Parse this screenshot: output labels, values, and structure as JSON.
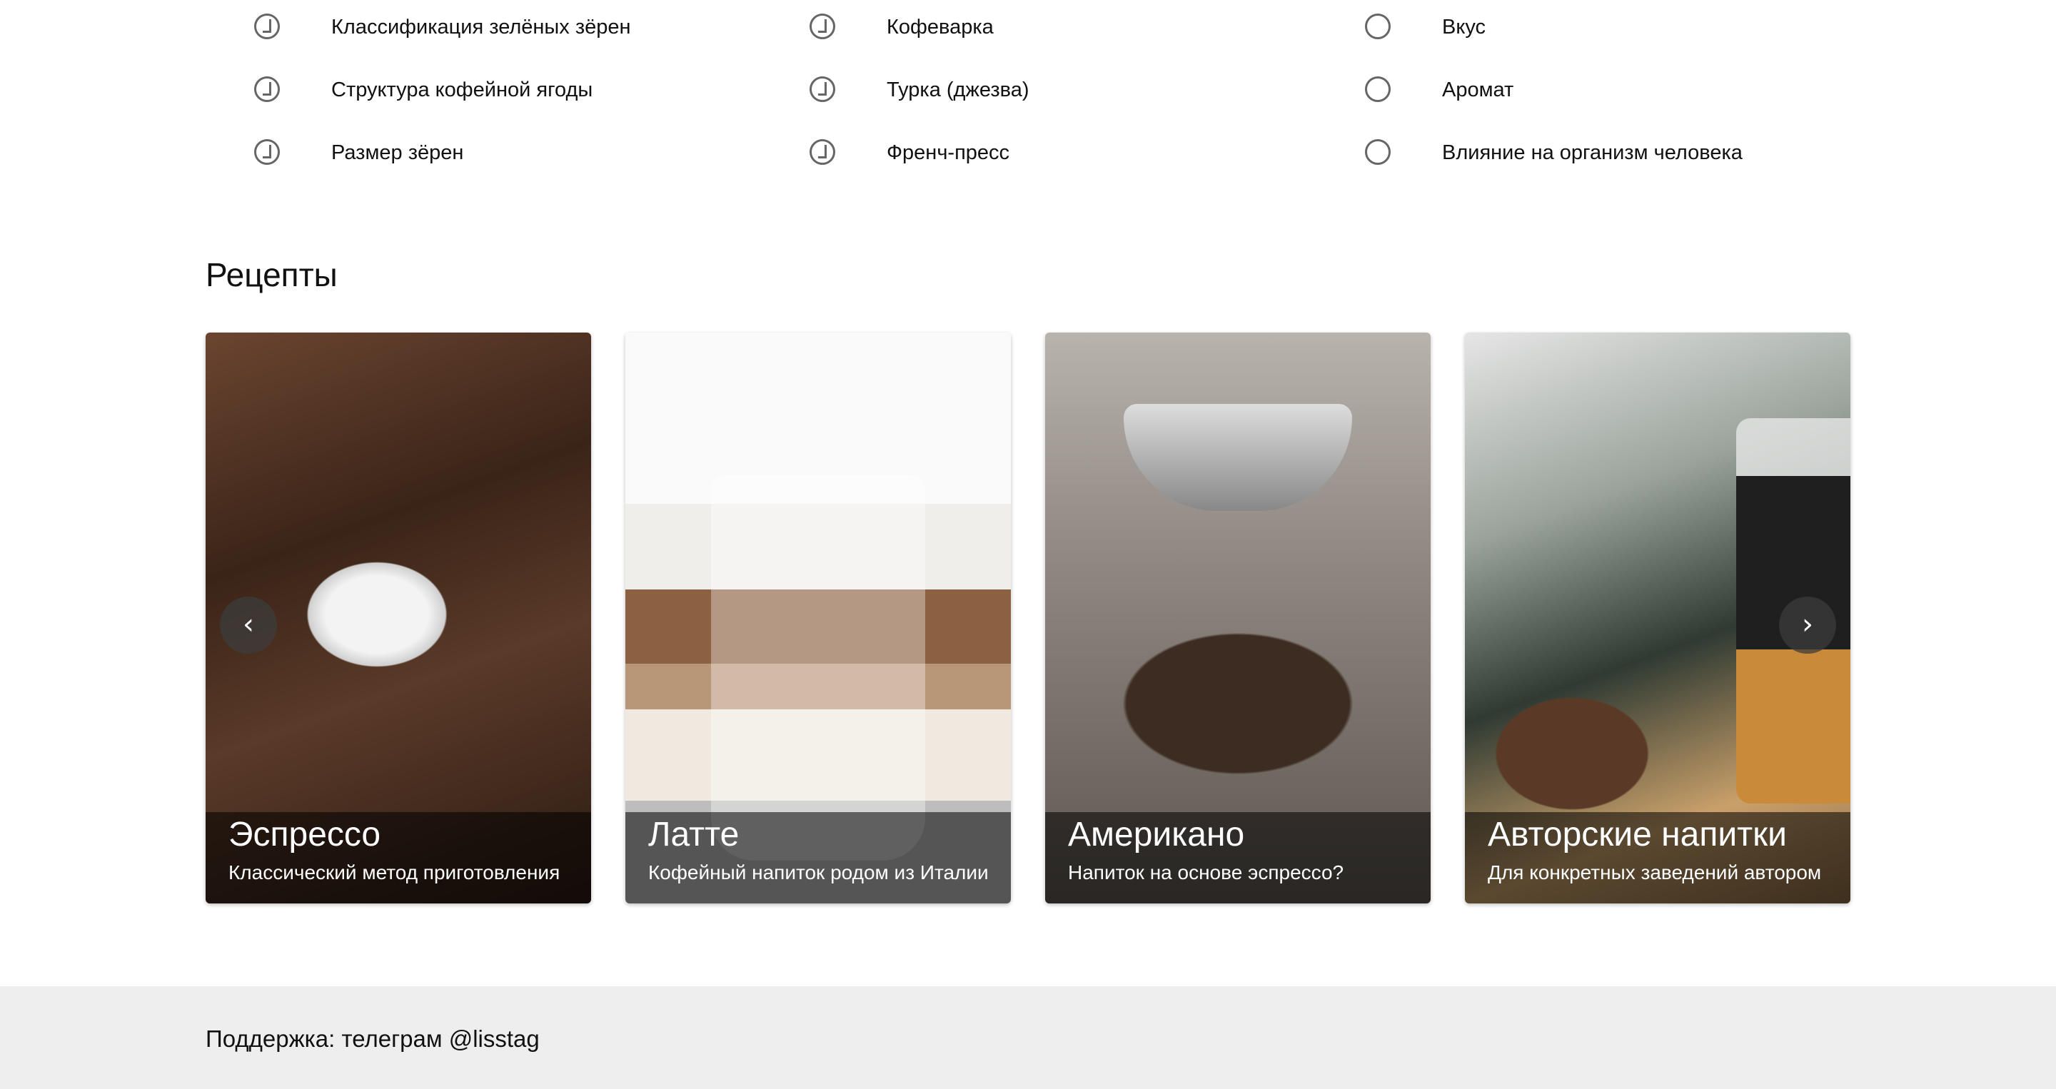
{
  "checklist": {
    "columns": [
      [
        {
          "label": "Классификация зелёных зёрен",
          "checked": true
        },
        {
          "label": "Структура кофейной ягоды",
          "checked": true
        },
        {
          "label": "Размер зёрен",
          "checked": true
        }
      ],
      [
        {
          "label": "Кофеварка",
          "checked": true
        },
        {
          "label": "Турка (джезва)",
          "checked": true
        },
        {
          "label": "Френч-пресс",
          "checked": true
        }
      ],
      [
        {
          "label": "Вкус",
          "checked": false
        },
        {
          "label": "Аромат",
          "checked": false
        },
        {
          "label": "Влияние на организм человека",
          "checked": false
        }
      ]
    ]
  },
  "recipes": {
    "title": "Рецепты",
    "cards": [
      {
        "title": "Эспрессо",
        "subtitle": "Классический метод приготовления"
      },
      {
        "title": "Латте",
        "subtitle": "Кофейный напиток родом из Италии"
      },
      {
        "title": "Американо",
        "subtitle": "Напиток на основе эспрессо?"
      },
      {
        "title": "Авторские напитки",
        "subtitle": "Для конкретных заведений автором"
      }
    ],
    "prev_icon": "chevron-left-icon",
    "next_icon": "chevron-right-icon"
  },
  "footer": {
    "support": "Поддержка: телеграм @lisstag"
  }
}
